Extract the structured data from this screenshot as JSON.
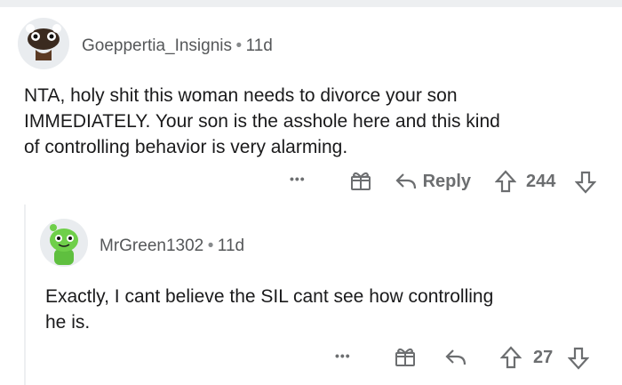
{
  "comments": [
    {
      "username": "Goeppertia_Insignis",
      "separator": "•",
      "time": "11d",
      "body_lines": [
        "NTA, holy shit this woman needs to divorce your son",
        "IMMEDIATELY. Your son is the asshole here and this kind",
        "of controlling behavior is very alarming."
      ],
      "more_label": "•••",
      "reply_label": "Reply",
      "score": "244"
    },
    {
      "username": "MrGreen1302",
      "separator": "•",
      "time": "11d",
      "body_lines": [
        "Exactly, I cant believe the SIL cant see how controlling",
        "he is."
      ],
      "more_label": "•••",
      "score": "27"
    }
  ],
  "colors": {
    "text": "#1a1a1b",
    "meta": "#555759",
    "action": "#6c6e70",
    "thread": "#edeff1",
    "avatar_green": "#5fbf3f"
  }
}
